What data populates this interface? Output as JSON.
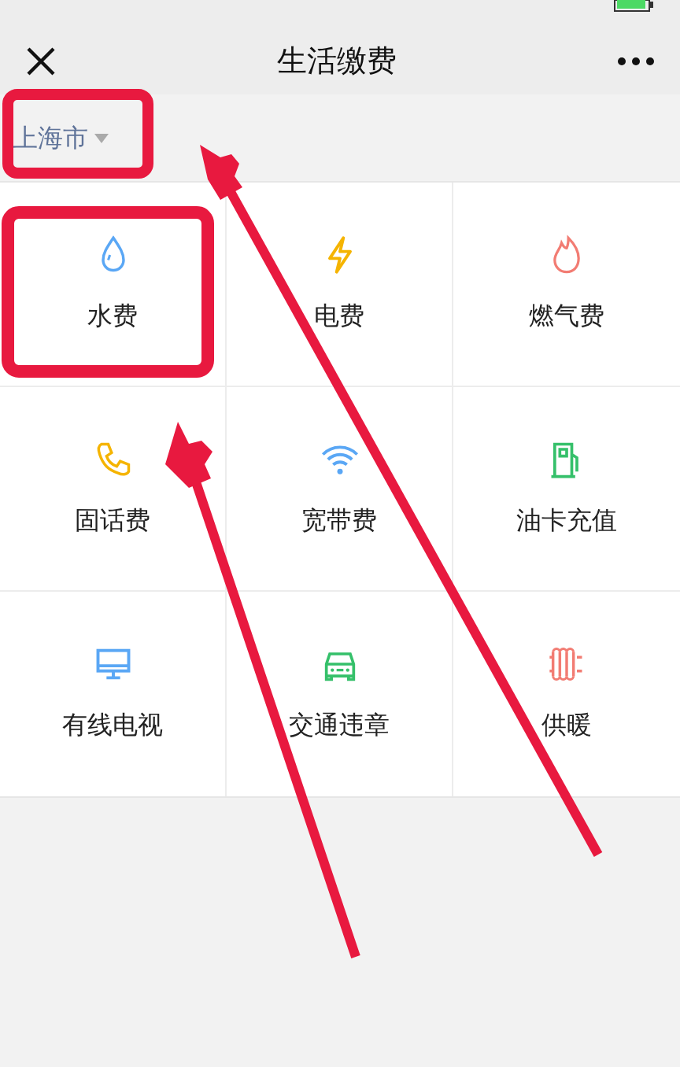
{
  "nav": {
    "title": "生活缴费"
  },
  "city": {
    "name": "上海市"
  },
  "services": [
    {
      "label": "水费",
      "kind": "drop"
    },
    {
      "label": "电费",
      "kind": "bolt"
    },
    {
      "label": "燃气费",
      "kind": "flame"
    },
    {
      "label": "固话费",
      "kind": "phone"
    },
    {
      "label": "宽带费",
      "kind": "wifi"
    },
    {
      "label": "油卡充值",
      "kind": "fuel"
    },
    {
      "label": "有线电视",
      "kind": "monitor"
    },
    {
      "label": "交通违章",
      "kind": "car"
    },
    {
      "label": "供暖",
      "kind": "radiator"
    }
  ]
}
